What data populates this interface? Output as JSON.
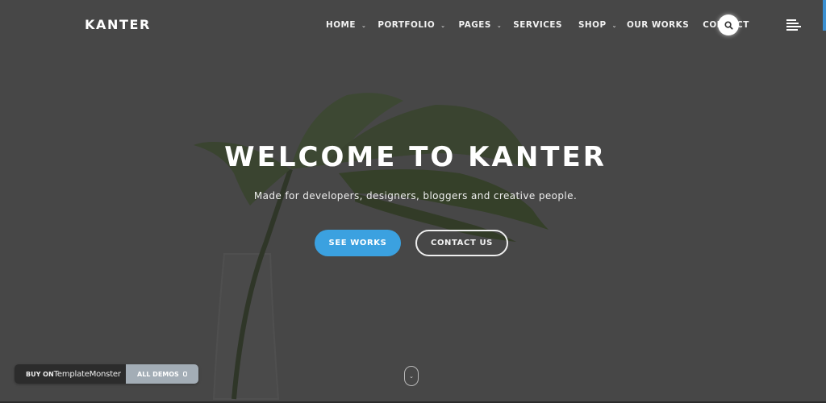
{
  "header": {
    "logo": "KANTER",
    "nav": [
      {
        "label": "HOME",
        "dropdown": true
      },
      {
        "label": "PORTFOLIO",
        "dropdown": true
      },
      {
        "label": "PAGES",
        "dropdown": true
      },
      {
        "label": "SERVICES",
        "dropdown": false
      },
      {
        "label": "SHOP",
        "dropdown": true
      },
      {
        "label": "OUR WORKS",
        "dropdown": false
      },
      {
        "label": "CONTACT",
        "dropdown": false
      }
    ],
    "chevron_glyph": "⌄",
    "search_icon": "search-icon",
    "menu_icon": "menu-lines-icon"
  },
  "hero": {
    "title": "WELCOME TO KANTER",
    "subtitle": "Made for developers, designers, bloggers and creative people.",
    "primary_button": "SEE WORKS",
    "secondary_button": "CONTACT US",
    "scroll_glyph": "⌄"
  },
  "promo": {
    "buy_prefix": "BUY ON",
    "buy_brand": "TemplateMonster",
    "all_demos": "ALL DEMOS"
  },
  "colors": {
    "background": "#474747",
    "accent": "#3ba1e0",
    "promo_dark": "#2c2c2c",
    "promo_light": "#a3adb6"
  }
}
